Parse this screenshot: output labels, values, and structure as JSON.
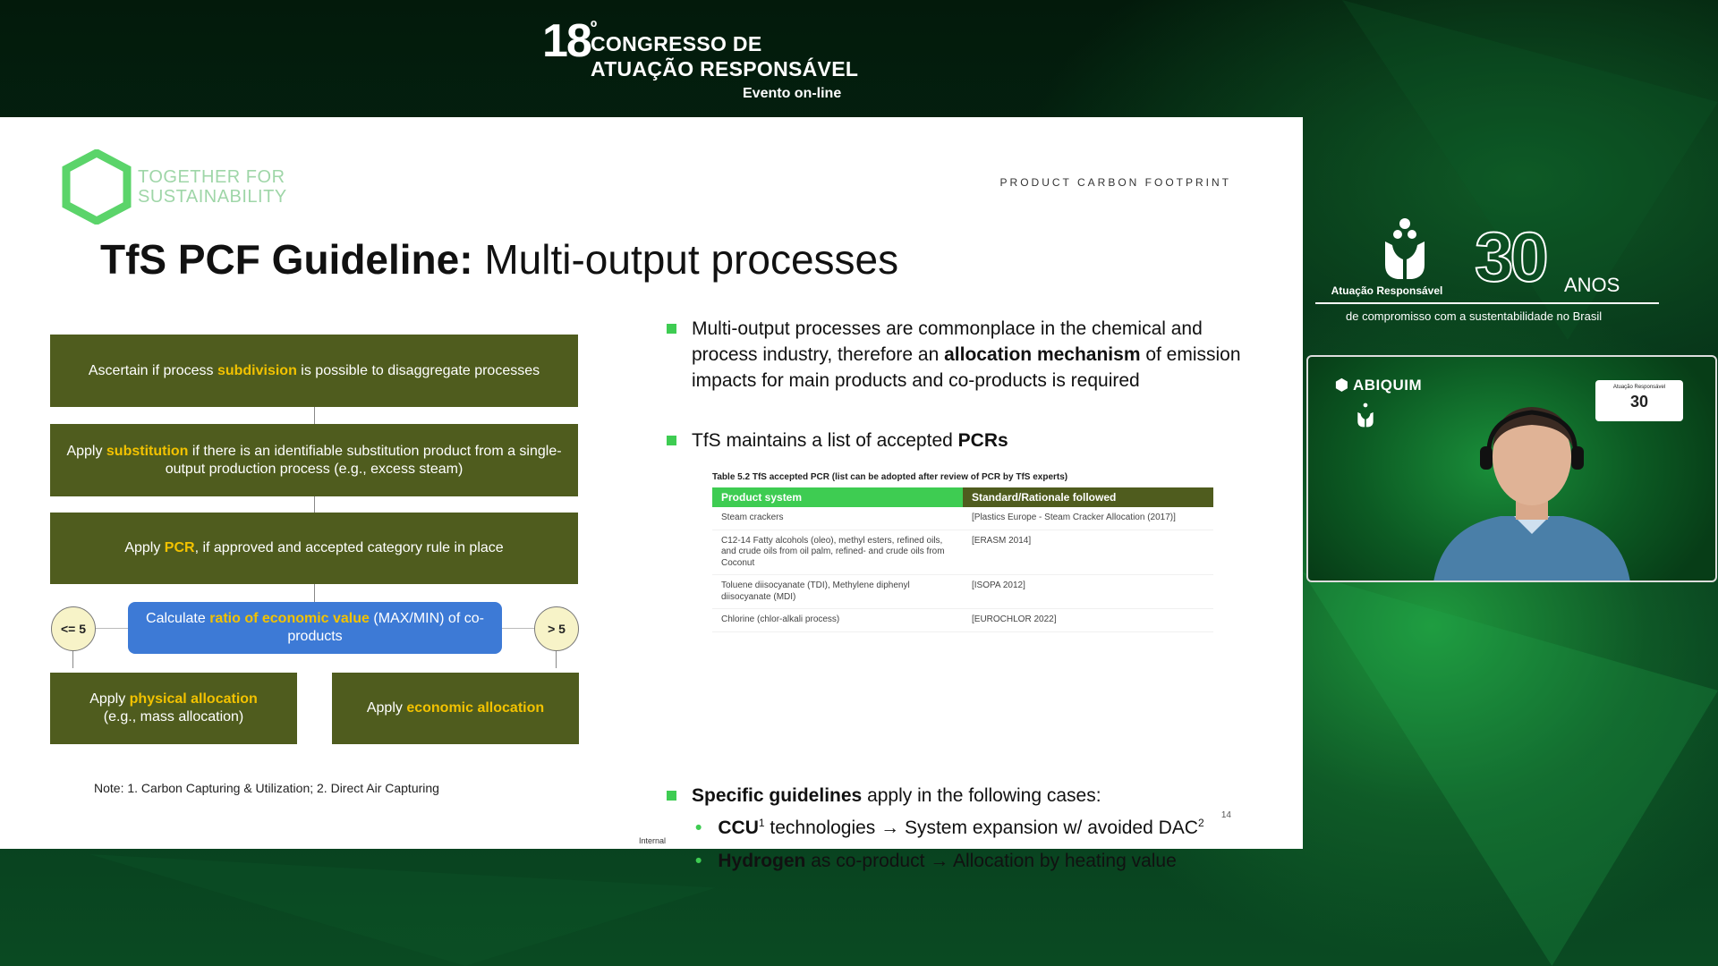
{
  "event": {
    "number": "18",
    "ordinal": "º",
    "line1": "CONGRESSO DE",
    "line2": "ATUAÇÃO RESPONSÁVEL",
    "line3": "Evento on-line"
  },
  "slide": {
    "logo_line1": "TOGETHER FOR",
    "logo_line2": "SUSTAINABILITY",
    "section_label": "PRODUCT CARBON FOOTPRINT",
    "title_bold": "TfS PCF Guideline:",
    "title_rest": " Multi-output processes",
    "flow": {
      "box1": {
        "pre": "Ascertain if process ",
        "hl": "subdivision",
        "post": " is possible to disaggregate processes"
      },
      "box2": {
        "pre": "Apply ",
        "hl": "substitution",
        "post": " if there is an identifiable substitution product from a single-output production process (e.g., excess steam)"
      },
      "box3": {
        "pre": "Apply ",
        "hl": "PCR",
        "post": ", if approved and accepted category rule in place"
      },
      "calc": {
        "pre": "Calculate ",
        "hl": "ratio of economic value",
        "post": " (MAX/MIN) of co-products"
      },
      "left_circle": "<= 5",
      "right_circle": "> 5",
      "box_physical": {
        "pre": "Apply ",
        "hl": "physical allocation",
        "post": " (e.g., mass allocation)"
      },
      "box_economic": {
        "pre": "Apply ",
        "hl": "economic allocation",
        "post": ""
      }
    },
    "note": "Note: 1. Carbon Capturing & Utilization; 2. Direct Air Capturing",
    "bullets": {
      "b1_pre": "Multi-output processes are commonplace in the chemical and process industry, therefore an ",
      "b1_bold": "allocation mechanism",
      "b1_post": " of emission impacts for main products and co-products is required",
      "b2_pre": "TfS maintains a list of accepted ",
      "b2_bold": "PCRs",
      "b3_bold": "Specific guidelines",
      "b3_post": " apply in the following cases:",
      "s1_bold": "CCU",
      "s1_sup": "1",
      "s1_rest": " technologies → System expansion w/ avoided DAC",
      "s1_sup2": "2",
      "s2_bold": "Hydrogen",
      "s2_rest": " as co-product → Allocation by heating value"
    },
    "table": {
      "caption": "Table 5.2  TfS accepted PCR (list can be adopted after review of PCR by TfS experts)",
      "headers": [
        "Product system",
        "Standard/Rationale followed"
      ],
      "rows": [
        [
          "Steam crackers",
          "[Plastics Europe - Steam Cracker Allocation (2017)]"
        ],
        [
          "C12-14 Fatty alcohols (oleo), methyl esters, refined oils, and crude oils from oil palm, refined- and crude oils from Coconut",
          "[ERASM 2014]"
        ],
        [
          "Toluene diisocyanate (TDI), Methylene diphenyl diisocyanate (MDI)",
          "[ISOPA 2012]"
        ],
        [
          "Chlorine (chlor-alkali process)",
          "[EUROCHLOR 2022]"
        ]
      ]
    },
    "page_number": "14",
    "classification": "Internal"
  },
  "anniversary": {
    "brand": "Atuação Responsável",
    "number": "30",
    "anos": "ANOS",
    "subtitle": "de compromisso com a sustentabilidade no Brasil"
  },
  "video": {
    "brand": "ABIQUIM",
    "badge_title": "Atuação Responsável",
    "badge_number": "30",
    "hands_label": "Atuação Responsável"
  },
  "colors": {
    "slide_box": "#4f5c1e",
    "highlight": "#f2c200",
    "calc_box": "#3d7ad6",
    "bullet": "#3ecc52",
    "table_head_green": "#3ecc52",
    "table_head_dark": "#4f5c1e"
  }
}
